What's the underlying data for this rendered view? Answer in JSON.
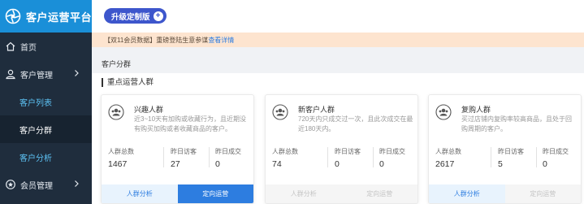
{
  "brand": {
    "title": "客户运营平台",
    "icon": "brand-logo-icon"
  },
  "sidebar": {
    "items": [
      {
        "label": "首页",
        "icon": "home-icon"
      },
      {
        "label": "客户管理",
        "icon": "user-icon",
        "expanded": true,
        "children": [
          {
            "label": "客户列表"
          },
          {
            "label": "客户分群",
            "active": true
          },
          {
            "label": "客户分析"
          }
        ]
      },
      {
        "label": "会员管理",
        "icon": "member-icon"
      }
    ]
  },
  "topbar": {
    "upgrade_label": "升级定制版"
  },
  "notice": {
    "text": "【双11会员数据】重磅登陆生意参谋",
    "link_text": "查看详情"
  },
  "page": {
    "section_label": "客户分群",
    "sub_title": "重点运营人群"
  },
  "cards": [
    {
      "name": "兴趣人群",
      "desc": "近3~10天有加购或收藏行为，且近期没有购买加购或者收藏商品的客户。",
      "stats": [
        {
          "label": "人群总数",
          "value": "1467"
        },
        {
          "label": "昨日访客",
          "value": "27"
        },
        {
          "label": "昨日成交",
          "value": "0"
        }
      ],
      "actions": {
        "analysis": "人群分析",
        "target": "定向运营"
      },
      "enabled": true
    },
    {
      "name": "新客户人群",
      "desc": "720天内只成交过一次，且此次成交在最近180天内。",
      "stats": [
        {
          "label": "人群总数",
          "value": "74"
        },
        {
          "label": "昨日访客",
          "value": "0"
        },
        {
          "label": "昨日成交",
          "value": "0"
        }
      ],
      "actions": {
        "analysis": "人群分析",
        "target": "定向运营"
      },
      "enabled": false
    },
    {
      "name": "复购人群",
      "desc": "买过店铺内复购率较高商品，且处于回购周期的客户。",
      "stats": [
        {
          "label": "人群总数",
          "value": "2617"
        },
        {
          "label": "昨日访客",
          "value": "5"
        },
        {
          "label": "昨日成交",
          "value": "0"
        }
      ],
      "actions": {
        "analysis": "人群分析",
        "target": "定向运营"
      },
      "enabled": "partial"
    }
  ],
  "colors": {
    "brand": "#1a8fd8",
    "sidebar": "#1f2d3d",
    "accent": "#2d7de0",
    "upgrade": "#3d56cc",
    "notice_bg": "#fde4cf"
  }
}
